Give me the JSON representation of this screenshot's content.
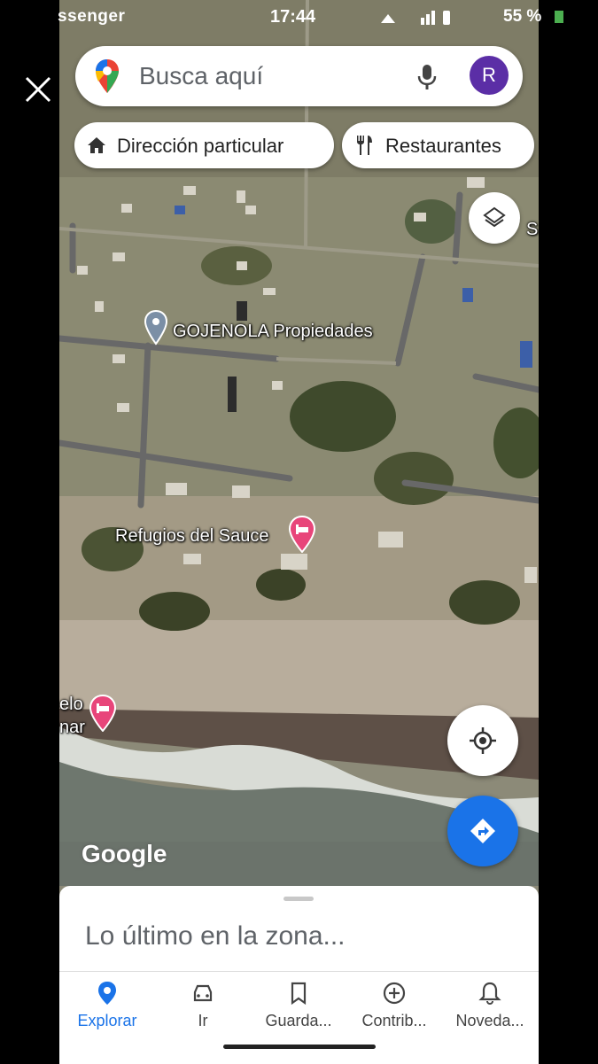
{
  "status": {
    "left_text": "ssenger",
    "time": "17:44",
    "battery": "55 %"
  },
  "search": {
    "placeholder": "Busca aquí",
    "avatar_letter": "R"
  },
  "chips": [
    {
      "label": "Dirección particular",
      "icon": "home-icon"
    },
    {
      "label": "Restaurantes",
      "icon": "fork-knife-icon"
    }
  ],
  "map_labels": {
    "place1": "GOJENOLA Propiedades",
    "place2": "Refugios del Sauce",
    "place3_line1": "elo",
    "place3_line2": "nar",
    "edge_letter": "S"
  },
  "attribution": "Google",
  "sheet": {
    "title": "Lo último en la zona..."
  },
  "nav": [
    {
      "label": "Explorar",
      "icon": "explore-pin-icon",
      "active": true
    },
    {
      "label": "Ir",
      "icon": "car-icon",
      "active": false
    },
    {
      "label": "Guarda...",
      "icon": "bookmark-icon",
      "active": false
    },
    {
      "label": "Contrib...",
      "icon": "plus-circle-icon",
      "active": false
    },
    {
      "label": "Noveda...",
      "icon": "bell-icon",
      "active": false
    }
  ],
  "colors": {
    "accent": "#1a73e8",
    "hotel_pin": "#e8457a",
    "avatar": "#5b2ea6"
  }
}
